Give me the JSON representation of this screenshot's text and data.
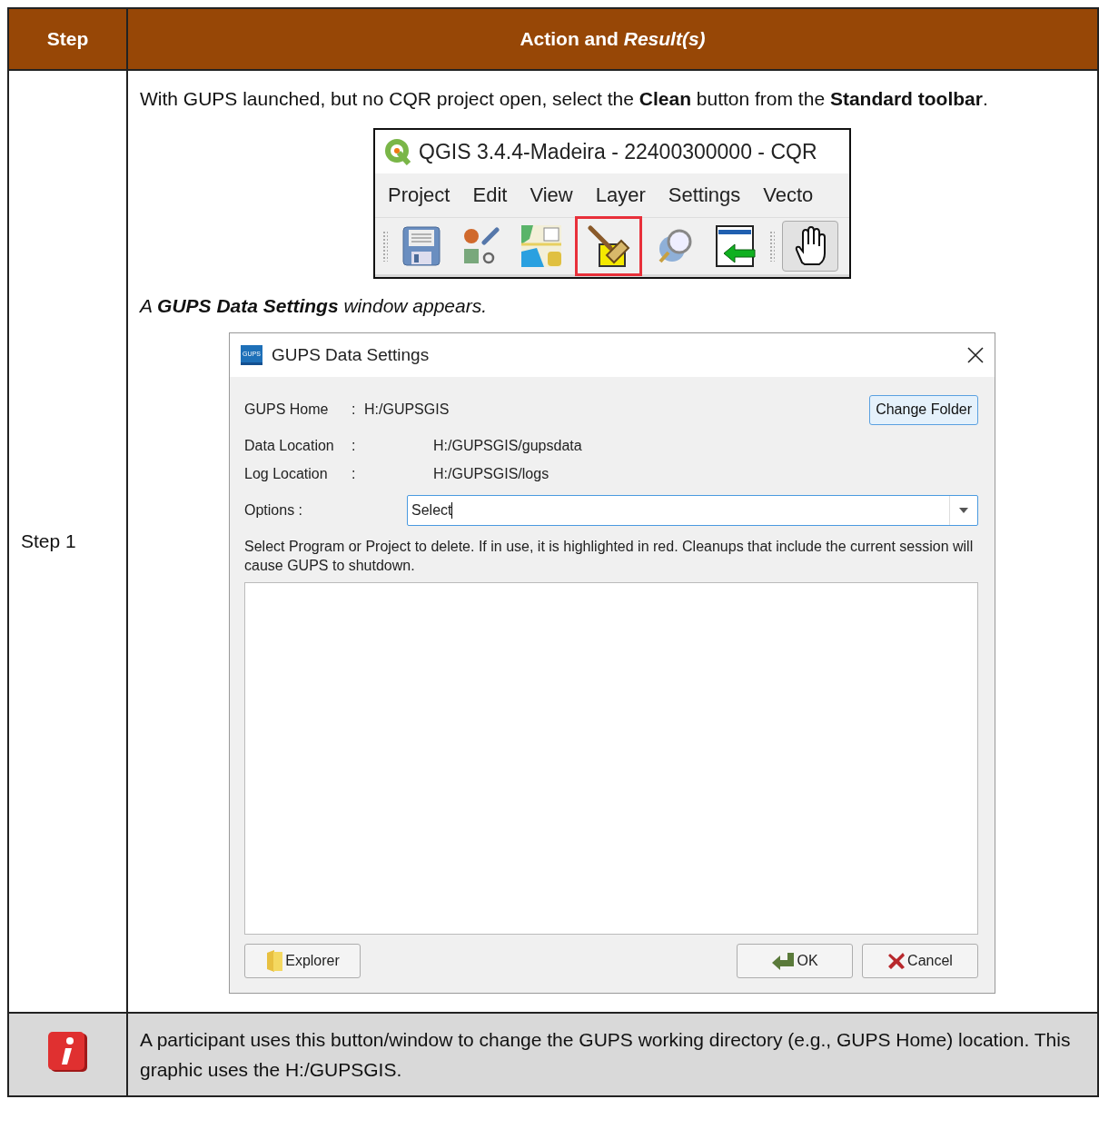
{
  "table": {
    "columns": [
      "Step",
      "Action and *Result(s)*"
    ],
    "rows": [
      {
        "step": "Step 1",
        "instruction": "With GUPS launched, but no CQR project open, select the **Clean** button from the **Standard toolbar**.",
        "qgis_window": {
          "title": "QGIS 3.4.4-Madeira - 22400300000 - CQR",
          "menus": [
            "Project",
            "Edit",
            "View",
            "Layer",
            "Settings",
            "Vecto"
          ],
          "tools": [
            {
              "kind": "save",
              "highlighted": false,
              "active": false
            },
            {
              "kind": "style",
              "highlighted": false,
              "active": false
            },
            {
              "kind": "map",
              "highlighted": false,
              "active": false
            },
            {
              "kind": "clean",
              "highlighted": true,
              "active": false
            },
            {
              "kind": "globe",
              "highlighted": false,
              "active": false
            },
            {
              "kind": "import",
              "highlighted": false,
              "active": false
            },
            {
              "kind": "pan",
              "highlighted": false,
              "active": true
            }
          ]
        },
        "result": "A **GUPS Data Settings** window appears.",
        "dialog": {
          "title": "GUPS Data Settings",
          "app_badge": "GUPS",
          "fields": [
            {
              "label": "GUPS Home",
              "separator": ":",
              "value": "H:/GUPSGIS"
            },
            {
              "label": "Data Location",
              "separator": ":",
              "value": "H:/GUPSGIS/gupsdata"
            },
            {
              "label": "Log Location",
              "separator": ":",
              "value": "H:/GUPSGIS/logs"
            }
          ],
          "change_folder_button": "Change Folder",
          "options": {
            "label": "Options :",
            "value": "Select"
          },
          "message": "Select Program or Project to delete. If in use, it is highlighted in red. Cleanups that include the current session will cause GUPS to shutdown.",
          "buttons": [
            {
              "kind": "explorer",
              "label": "Explorer"
            },
            {
              "kind": "ok",
              "label": "OK"
            },
            {
              "kind": "cancel",
              "label": "Cancel"
            }
          ]
        }
      }
    ],
    "note": {
      "text": "A participant uses this button/window to change the GUPS working directory (e.g., GUPS Home) location. This graphic uses the H:/GUPSGIS."
    }
  }
}
